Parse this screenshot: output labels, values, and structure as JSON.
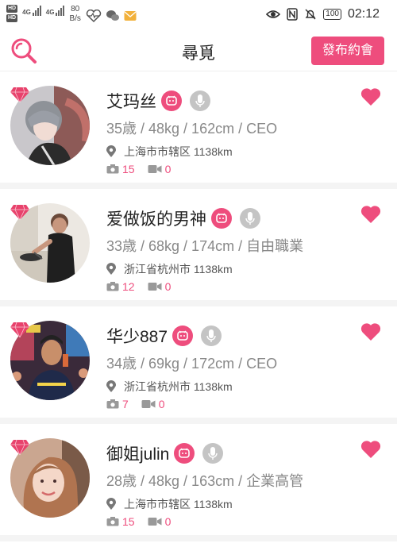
{
  "status_bar": {
    "sim1": "HD",
    "sim2": "HD",
    "net1": "4G",
    "net2": "4G",
    "speed_value": "80",
    "speed_unit": "B/s",
    "battery": "100",
    "time": "02:12"
  },
  "header": {
    "title": "尋覓",
    "post_label": "發布約會"
  },
  "colors": {
    "accent": "#ee4d7d",
    "gem": "#e8426c",
    "grey_icon": "#c4c4c4"
  },
  "users": [
    {
      "name": "艾玛丝",
      "stats": "35歳 / 48kg / 162cm / CEO",
      "location": "上海市市辖区 1138km",
      "photos": "15",
      "videos": "0"
    },
    {
      "name": "爱做饭的男神",
      "stats": "33歳 / 68kg / 174cm / 自由職業",
      "location": "浙江省杭州市 1138km",
      "photos": "12",
      "videos": "0"
    },
    {
      "name": "华少887",
      "stats": "34歳 / 69kg / 172cm / CEO",
      "location": "浙江省杭州市 1138km",
      "photos": "7",
      "videos": "0"
    },
    {
      "name": "御姐julin",
      "stats": "28歳 / 48kg / 163cm / 企業高管",
      "location": "上海市市辖区 1138km",
      "photos": "15",
      "videos": "0"
    }
  ]
}
